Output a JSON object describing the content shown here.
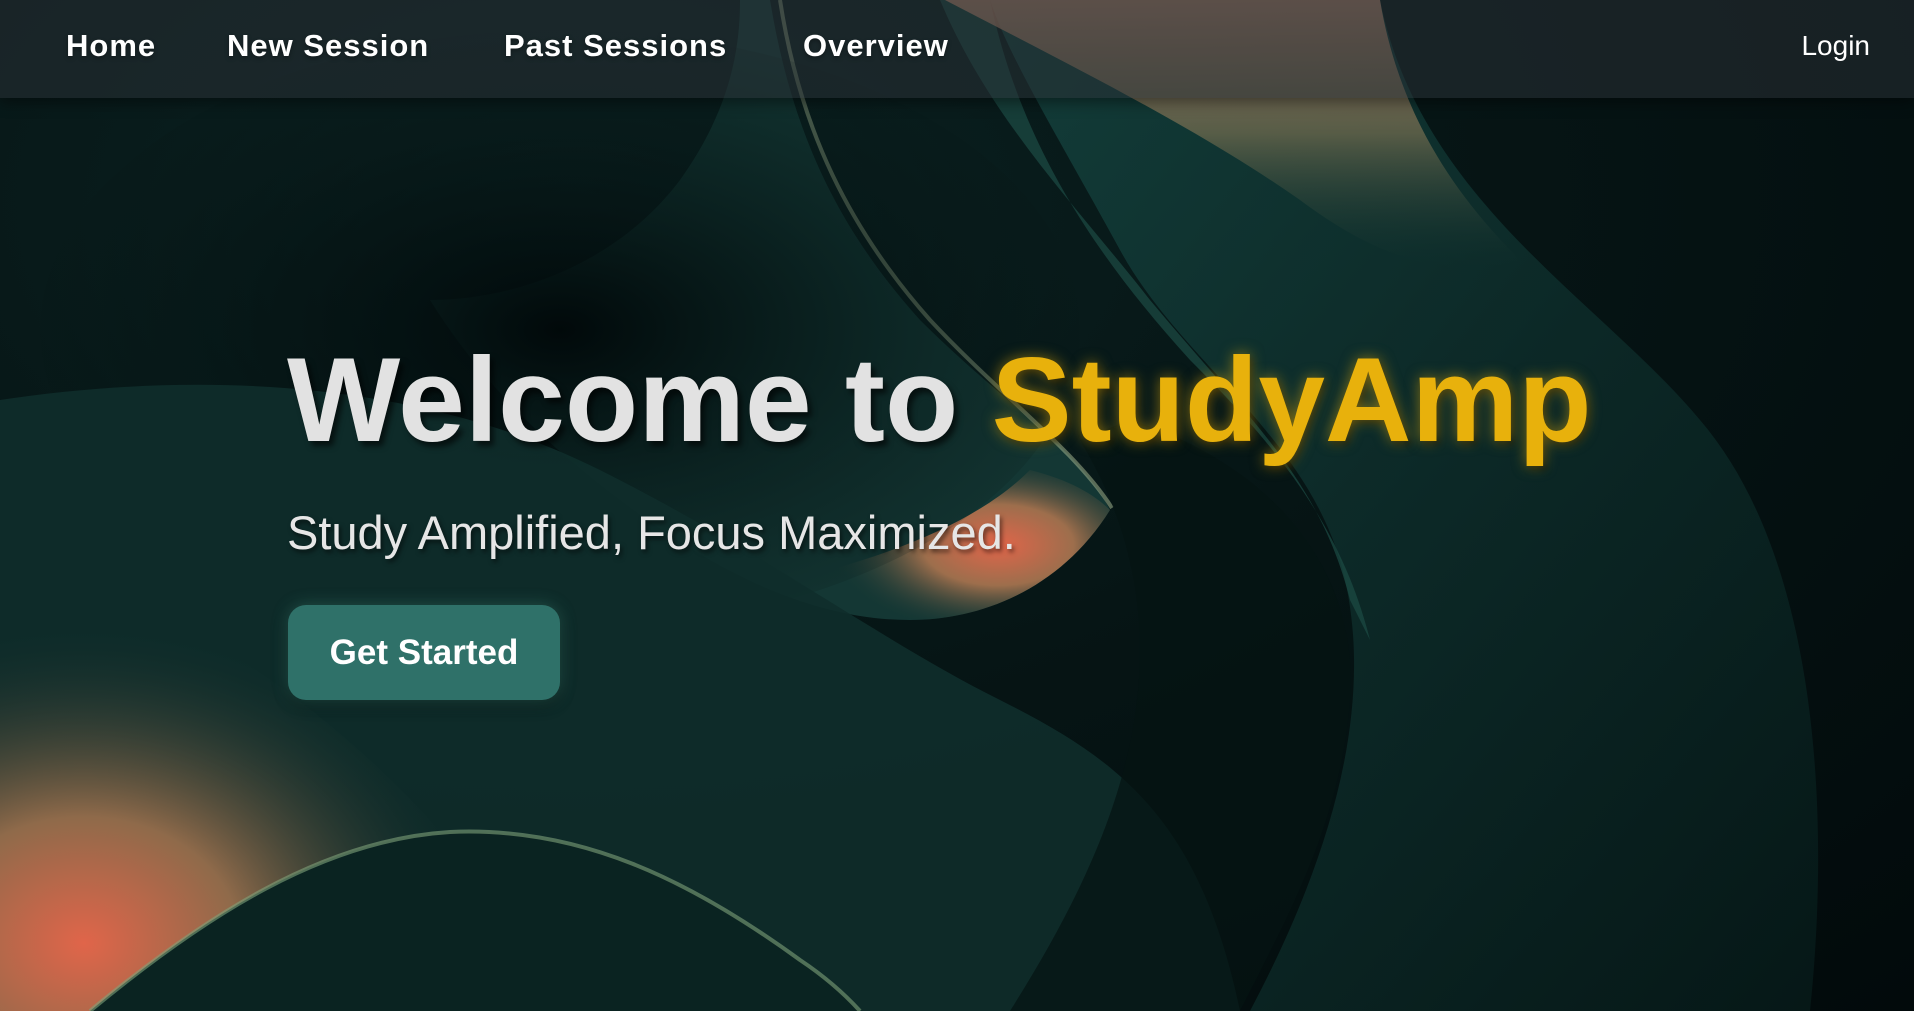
{
  "nav": {
    "items": [
      {
        "label": "Home"
      },
      {
        "label": "New Session"
      },
      {
        "label": "Past Sessions"
      },
      {
        "label": "Overview"
      }
    ],
    "login_label": "Login"
  },
  "hero": {
    "title_prefix": "Welcome to ",
    "brand_name": "StudyAmp",
    "subtitle": "Study Amplified, Focus Maximized.",
    "cta_label": "Get Started"
  },
  "colors": {
    "brand": "#e8b10c",
    "button": "#2f7169",
    "background": "#061515",
    "coral": "#e0654a"
  }
}
